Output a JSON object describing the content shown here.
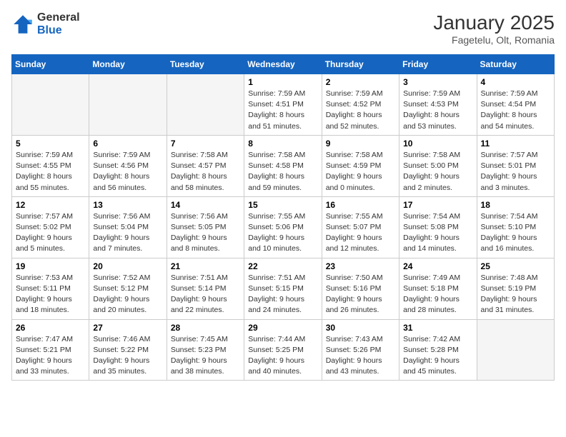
{
  "header": {
    "logo_general": "General",
    "logo_blue": "Blue",
    "month_title": "January 2025",
    "location": "Fagetelu, Olt, Romania"
  },
  "weekdays": [
    "Sunday",
    "Monday",
    "Tuesday",
    "Wednesday",
    "Thursday",
    "Friday",
    "Saturday"
  ],
  "weeks": [
    [
      {
        "day": "",
        "sunrise": "",
        "sunset": "",
        "daylight": ""
      },
      {
        "day": "",
        "sunrise": "",
        "sunset": "",
        "daylight": ""
      },
      {
        "day": "",
        "sunrise": "",
        "sunset": "",
        "daylight": ""
      },
      {
        "day": "1",
        "sunrise": "Sunrise: 7:59 AM",
        "sunset": "Sunset: 4:51 PM",
        "daylight": "Daylight: 8 hours and 51 minutes."
      },
      {
        "day": "2",
        "sunrise": "Sunrise: 7:59 AM",
        "sunset": "Sunset: 4:52 PM",
        "daylight": "Daylight: 8 hours and 52 minutes."
      },
      {
        "day": "3",
        "sunrise": "Sunrise: 7:59 AM",
        "sunset": "Sunset: 4:53 PM",
        "daylight": "Daylight: 8 hours and 53 minutes."
      },
      {
        "day": "4",
        "sunrise": "Sunrise: 7:59 AM",
        "sunset": "Sunset: 4:54 PM",
        "daylight": "Daylight: 8 hours and 54 minutes."
      }
    ],
    [
      {
        "day": "5",
        "sunrise": "Sunrise: 7:59 AM",
        "sunset": "Sunset: 4:55 PM",
        "daylight": "Daylight: 8 hours and 55 minutes."
      },
      {
        "day": "6",
        "sunrise": "Sunrise: 7:59 AM",
        "sunset": "Sunset: 4:56 PM",
        "daylight": "Daylight: 8 hours and 56 minutes."
      },
      {
        "day": "7",
        "sunrise": "Sunrise: 7:58 AM",
        "sunset": "Sunset: 4:57 PM",
        "daylight": "Daylight: 8 hours and 58 minutes."
      },
      {
        "day": "8",
        "sunrise": "Sunrise: 7:58 AM",
        "sunset": "Sunset: 4:58 PM",
        "daylight": "Daylight: 8 hours and 59 minutes."
      },
      {
        "day": "9",
        "sunrise": "Sunrise: 7:58 AM",
        "sunset": "Sunset: 4:59 PM",
        "daylight": "Daylight: 9 hours and 0 minutes."
      },
      {
        "day": "10",
        "sunrise": "Sunrise: 7:58 AM",
        "sunset": "Sunset: 5:00 PM",
        "daylight": "Daylight: 9 hours and 2 minutes."
      },
      {
        "day": "11",
        "sunrise": "Sunrise: 7:57 AM",
        "sunset": "Sunset: 5:01 PM",
        "daylight": "Daylight: 9 hours and 3 minutes."
      }
    ],
    [
      {
        "day": "12",
        "sunrise": "Sunrise: 7:57 AM",
        "sunset": "Sunset: 5:02 PM",
        "daylight": "Daylight: 9 hours and 5 minutes."
      },
      {
        "day": "13",
        "sunrise": "Sunrise: 7:56 AM",
        "sunset": "Sunset: 5:04 PM",
        "daylight": "Daylight: 9 hours and 7 minutes."
      },
      {
        "day": "14",
        "sunrise": "Sunrise: 7:56 AM",
        "sunset": "Sunset: 5:05 PM",
        "daylight": "Daylight: 9 hours and 8 minutes."
      },
      {
        "day": "15",
        "sunrise": "Sunrise: 7:55 AM",
        "sunset": "Sunset: 5:06 PM",
        "daylight": "Daylight: 9 hours and 10 minutes."
      },
      {
        "day": "16",
        "sunrise": "Sunrise: 7:55 AM",
        "sunset": "Sunset: 5:07 PM",
        "daylight": "Daylight: 9 hours and 12 minutes."
      },
      {
        "day": "17",
        "sunrise": "Sunrise: 7:54 AM",
        "sunset": "Sunset: 5:08 PM",
        "daylight": "Daylight: 9 hours and 14 minutes."
      },
      {
        "day": "18",
        "sunrise": "Sunrise: 7:54 AM",
        "sunset": "Sunset: 5:10 PM",
        "daylight": "Daylight: 9 hours and 16 minutes."
      }
    ],
    [
      {
        "day": "19",
        "sunrise": "Sunrise: 7:53 AM",
        "sunset": "Sunset: 5:11 PM",
        "daylight": "Daylight: 9 hours and 18 minutes."
      },
      {
        "day": "20",
        "sunrise": "Sunrise: 7:52 AM",
        "sunset": "Sunset: 5:12 PM",
        "daylight": "Daylight: 9 hours and 20 minutes."
      },
      {
        "day": "21",
        "sunrise": "Sunrise: 7:51 AM",
        "sunset": "Sunset: 5:14 PM",
        "daylight": "Daylight: 9 hours and 22 minutes."
      },
      {
        "day": "22",
        "sunrise": "Sunrise: 7:51 AM",
        "sunset": "Sunset: 5:15 PM",
        "daylight": "Daylight: 9 hours and 24 minutes."
      },
      {
        "day": "23",
        "sunrise": "Sunrise: 7:50 AM",
        "sunset": "Sunset: 5:16 PM",
        "daylight": "Daylight: 9 hours and 26 minutes."
      },
      {
        "day": "24",
        "sunrise": "Sunrise: 7:49 AM",
        "sunset": "Sunset: 5:18 PM",
        "daylight": "Daylight: 9 hours and 28 minutes."
      },
      {
        "day": "25",
        "sunrise": "Sunrise: 7:48 AM",
        "sunset": "Sunset: 5:19 PM",
        "daylight": "Daylight: 9 hours and 31 minutes."
      }
    ],
    [
      {
        "day": "26",
        "sunrise": "Sunrise: 7:47 AM",
        "sunset": "Sunset: 5:21 PM",
        "daylight": "Daylight: 9 hours and 33 minutes."
      },
      {
        "day": "27",
        "sunrise": "Sunrise: 7:46 AM",
        "sunset": "Sunset: 5:22 PM",
        "daylight": "Daylight: 9 hours and 35 minutes."
      },
      {
        "day": "28",
        "sunrise": "Sunrise: 7:45 AM",
        "sunset": "Sunset: 5:23 PM",
        "daylight": "Daylight: 9 hours and 38 minutes."
      },
      {
        "day": "29",
        "sunrise": "Sunrise: 7:44 AM",
        "sunset": "Sunset: 5:25 PM",
        "daylight": "Daylight: 9 hours and 40 minutes."
      },
      {
        "day": "30",
        "sunrise": "Sunrise: 7:43 AM",
        "sunset": "Sunset: 5:26 PM",
        "daylight": "Daylight: 9 hours and 43 minutes."
      },
      {
        "day": "31",
        "sunrise": "Sunrise: 7:42 AM",
        "sunset": "Sunset: 5:28 PM",
        "daylight": "Daylight: 9 hours and 45 minutes."
      },
      {
        "day": "",
        "sunrise": "",
        "sunset": "",
        "daylight": ""
      }
    ]
  ]
}
